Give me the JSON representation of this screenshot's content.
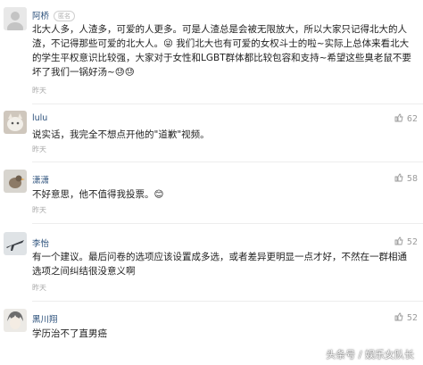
{
  "comments": [
    {
      "user": "阿桥",
      "badge": "匿名",
      "likes": "",
      "text": "北大人多，人渣多，可爱的人更多。可是人渣总是会被无限放大，所以大家只记得北大的人渣，不记得那些可爱的北大人。😜 我们北大也有可爱的女权斗士的啦~实际上总体来看北大的学生平权意识比较强，大家对于女性和LGBT群体都比较包容和支持~希望这些臭老鼠不要坏了我们一锅好汤~😓😓",
      "time": "昨天",
      "avatar_icon": "anonymous-avatar-icon"
    },
    {
      "user": "lulu",
      "badge": "",
      "likes": "62",
      "text": "说实话，我完全不想点开他的\"道歉\"视频。",
      "time": "昨天",
      "avatar_icon": "cat-avatar-icon"
    },
    {
      "user": "潇潇",
      "badge": "",
      "likes": "58",
      "text": "不好意思，他不值得我投票。😊",
      "time": "昨天",
      "avatar_icon": "bird-avatar-icon"
    },
    {
      "user": "李怡",
      "badge": "",
      "likes": "52",
      "text": "有一个建议。最后问卷的选项应该设置成多选，或者差异更明显一点才好，不然在一群相通选项之间纠结很没意义啊",
      "time": "昨天",
      "avatar_icon": "plane-avatar-icon"
    },
    {
      "user": "黑川翔",
      "badge": "",
      "likes": "52",
      "text": "学历治不了直男癌",
      "time": "",
      "avatar_icon": "anime-avatar-icon"
    }
  ],
  "watermark": "头条号 / 娱乐女队长",
  "colors": {
    "username": "#2a4f7a",
    "meta": "#a8a8a8",
    "text": "#222222"
  }
}
